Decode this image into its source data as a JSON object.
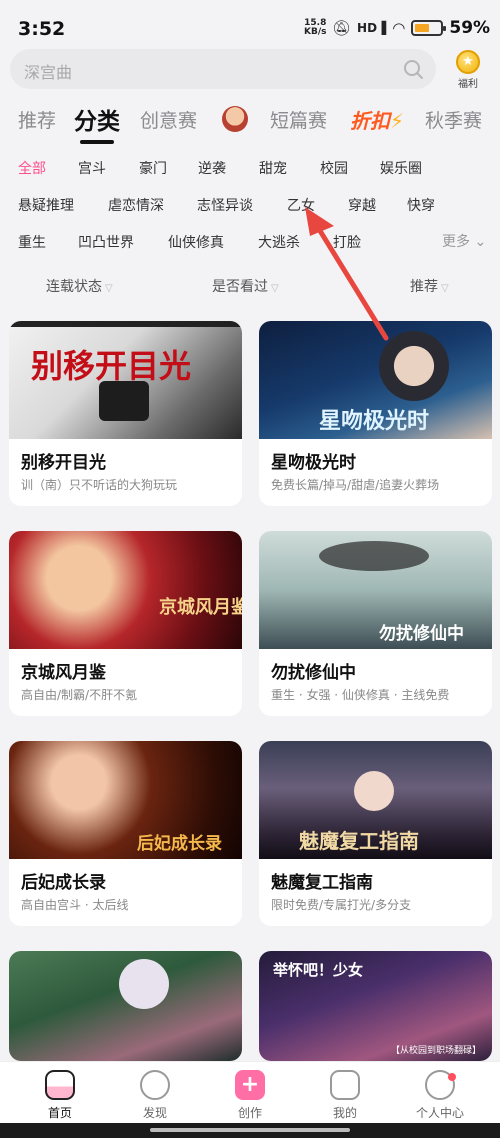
{
  "status": {
    "time": "3:52",
    "net_speed": "15.8",
    "net_unit": "KB/s",
    "battery": "59%",
    "battery_level": 0.59,
    "icons": [
      "bell-off-icon",
      "signal-hd-icon",
      "wifi-icon",
      "battery-icon"
    ]
  },
  "search": {
    "placeholder": "深宫曲",
    "welfare_label": "福利"
  },
  "tabs": {
    "recommend": "推荐",
    "category": "分类",
    "creative": "创意赛",
    "short": "短篇赛",
    "sale": "折扣",
    "autumn": "秋季赛"
  },
  "genres": {
    "row1": [
      "全部",
      "宫斗",
      "豪门",
      "逆袭",
      "甜宠",
      "校园",
      "娱乐圈"
    ],
    "row2": [
      "悬疑推理",
      "虐恋情深",
      "志怪异谈",
      "乙女",
      "穿越",
      "快穿"
    ],
    "row3": [
      "重生",
      "凹凸世界",
      "仙侠修真",
      "大逃杀",
      "打脸"
    ],
    "more": "更多"
  },
  "filters": {
    "serial": "连载状态",
    "watched": "是否看过",
    "sort": "推荐"
  },
  "cards": [
    {
      "title": "别移开目光",
      "tags": "训（南）只不听话的大狗玩玩",
      "overlay": "别移开目光",
      "badge": ""
    },
    {
      "title": "星吻极光时",
      "tags": "免费长篇/掉马/甜虐/追妻火葬场",
      "overlay": "星吻极光时"
    },
    {
      "title": "京城风月鉴",
      "tags": "高自由/制霸/不肝不氪",
      "overlay": "京城风月鉴"
    },
    {
      "title": "勿扰修仙中",
      "tags": "重生 · 女强 · 仙侠修真 · 主线免费",
      "overlay": "勿扰修仙中"
    },
    {
      "title": "后妃成长录",
      "tags": "高自由宫斗 · 太后线",
      "overlay": "后妃成长录"
    },
    {
      "title": "魅魔复工指南",
      "tags": "限时免费/专属打光/多分支",
      "overlay": "魅魔复工指南"
    },
    {
      "overlay": ""
    },
    {
      "overlay": "举怀吧！少女",
      "caption": "【从校园到职场翻碌】"
    }
  ],
  "nav": [
    {
      "label": "首页",
      "icon": "home-icon"
    },
    {
      "label": "发现",
      "icon": "discover-icon"
    },
    {
      "label": "创作",
      "icon": "create-icon"
    },
    {
      "label": "我的",
      "icon": "folder-icon"
    },
    {
      "label": "个人中心",
      "icon": "profile-icon"
    }
  ],
  "colors": {
    "accent": "#ff4f8b",
    "sale": "#ff5a1f",
    "arrow": "#e8473f"
  }
}
